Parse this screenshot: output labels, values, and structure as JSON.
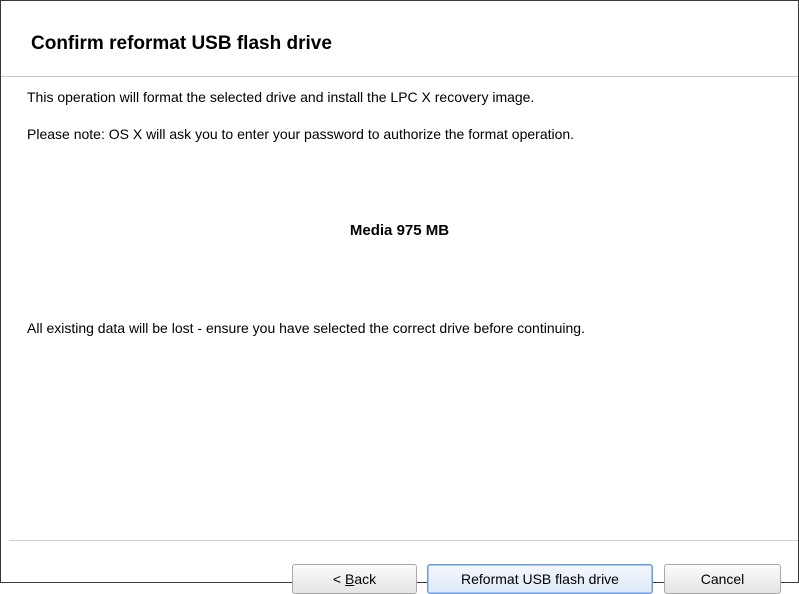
{
  "dialog": {
    "title": "Confirm reformat USB flash drive",
    "line1": "This operation will format the selected drive and install the LPC X recovery image.",
    "line2": "Please note: OS X will ask you to enter your password to authorize the format operation.",
    "drive": "Media 975 MB",
    "line3": "All existing data will be lost - ensure you have selected the correct drive before continuing."
  },
  "buttons": {
    "back_prefix": "< ",
    "back_mnemonic": "B",
    "back_rest": "ack",
    "reformat": "Reformat USB flash drive",
    "cancel": "Cancel"
  }
}
